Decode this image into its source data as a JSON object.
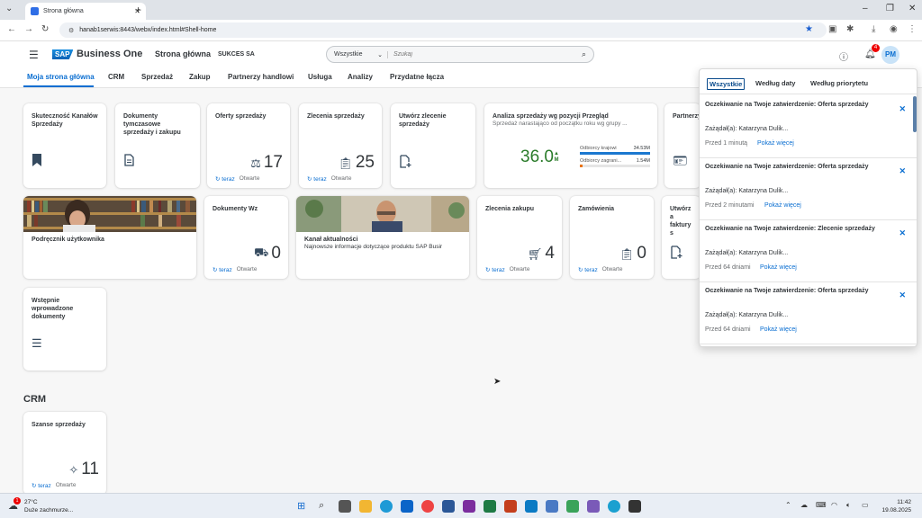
{
  "browser": {
    "tab_title": "Strona główna",
    "url": "hanab1serwis:8443/webx/index.html#Shell-home"
  },
  "shell": {
    "product": "Business One",
    "logo": "SAP",
    "page_title": "Strona główna",
    "company": "SUKCES SA",
    "search_scope": "Wszystkie",
    "search_placeholder": "Szukaj",
    "notification_count": "4",
    "avatar_initials": "PM"
  },
  "subnav": {
    "items": [
      "Moja strona główna",
      "CRM",
      "Sprzedaż",
      "Zakup",
      "Partnerzy handlowi",
      "Usługa",
      "Analizy",
      "Przydatne łącza"
    ]
  },
  "tiles": {
    "refresh_label": "teraz",
    "open_label": "Otwarte",
    "t1": {
      "title": "Skuteczność Kanałów Sprzedaży",
      "icon": "bookmark-icon"
    },
    "t2": {
      "title": "Dokumenty tymczasowe sprzedaży i zakupu",
      "icon": "document-icon"
    },
    "t3": {
      "title": "Oferty sprzedaży",
      "value": "17",
      "icon": "scales-icon"
    },
    "t4": {
      "title": "Zlecenia sprzedaży",
      "value": "25",
      "icon": "clipboard-icon"
    },
    "t5": {
      "title": "Utwórz zlecenie sprzedaży",
      "icon": "add-document-icon"
    },
    "t6": {
      "title": "Analiza sprzedaży wg pozycji Przegląd",
      "subtitle": "Sprzedaż narastająco od początku roku wg grupy ...",
      "value": "36.0",
      "unit": "M"
    },
    "t7": {
      "title": "Partnerzy",
      "icon": "contact-card-icon"
    },
    "t8": {
      "title": "Podręcznik użytkownika"
    },
    "t9": {
      "title": "Dokumenty Wz",
      "value": "0",
      "icon": "truck-icon"
    },
    "t10": {
      "title": "Kanał aktualności",
      "subtitle": "Najnowsze informacje dotyczące produktu SAP Busir"
    },
    "t11": {
      "title": "Zlecenia zakupu",
      "value": "4",
      "icon": "cart-icon"
    },
    "t12": {
      "title": "Zamówienia",
      "value": "0",
      "icon": "clipboard-icon"
    },
    "t13": {
      "title": "Utwórz a faktury s",
      "icon": "add-document-icon"
    },
    "t14": {
      "title": "Wstępnie wprowadzone dokumenty",
      "icon": "list-icon"
    },
    "t15": {
      "title": "Szanse sprzedaży",
      "value": "11",
      "icon": "opportunity-icon"
    }
  },
  "crm_section": "CRM",
  "chart_data": {
    "type": "bar",
    "categories": [
      "Odbiorcy krajowi",
      "Odbiorcy zagrani..."
    ],
    "values": [
      34.53,
      1.54
    ],
    "value_labels": [
      "34.53M",
      "1.54M"
    ],
    "colors": [
      "#1b78d0",
      "#e9730c"
    ]
  },
  "notifications": {
    "tabs": [
      "Wszystkie",
      "Według daty",
      "Według priorytetu"
    ],
    "show_more": "Pokaż więcej",
    "items": [
      {
        "title": "Oczekiwanie na Twoje zatwierdzenie: Oferta sprzedaży",
        "who": "Zażądał(a): Katarzyna Dulik...",
        "time": "Przed 1 minutą"
      },
      {
        "title": "Oczekiwanie na Twoje zatwierdzenie: Oferta sprzedaży",
        "who": "Zażądał(a): Katarzyna Dulik...",
        "time": "Przed 2 minutami"
      },
      {
        "title": "Oczekiwanie na Twoje zatwierdzenie: Zlecenie sprzedaży",
        "who": "Zażądał(a): Katarzyna Dulik...",
        "time": "Przed 64 dniami"
      },
      {
        "title": "Oczekiwanie na Twoje zatwierdzenie: Oferta sprzedaży",
        "who": "Zażądał(a): Katarzyna Dulik...",
        "time": "Przed 64 dniami"
      }
    ]
  },
  "taskbar": {
    "weather_badge": "1",
    "temperature": "27°C",
    "weather": "Duże zachmurze...",
    "time": "11:42",
    "date": "19.08.2025"
  }
}
